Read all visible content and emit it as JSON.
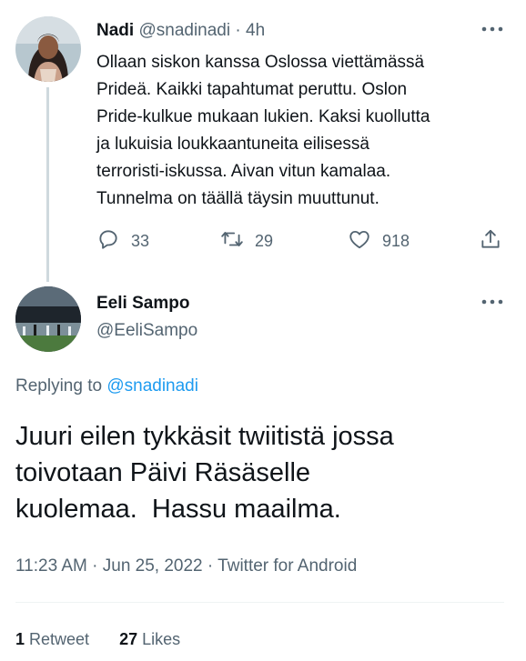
{
  "parent_tweet": {
    "author_name": "Nadi",
    "author_handle": "@snadinadi",
    "separator": " · ",
    "time_ago": "4h",
    "lines": [
      "Ollaan siskon kanssa Oslossa viettämässä",
      "Prideä. Kaikki tapahtumat peruttu. Oslon",
      "Pride-kulkue mukaan lukien. Kaksi kuollutta",
      "ja lukuisia loukkaantuneita eilisessä",
      "terroristi-iskussa. Aivan vitun kamalaa.",
      "Tunnelma on täällä täysin muuttunut."
    ],
    "reply_count": "33",
    "retweet_count": "29",
    "like_count": "918"
  },
  "reply_tweet": {
    "author_name": "Eeli Sampo",
    "author_handle": "@EeliSampo",
    "replying_prefix": "Replying to ",
    "replying_to": "@snadinadi",
    "lines": [
      "Juuri eilen tykkäsit twiitistä jossa",
      "toivotaan Päivi Räsäselle",
      "kuolemaa.  Hassu maailma."
    ],
    "timestamp": "11:23 AM · Jun 25, 2022 · Twitter for Android",
    "retweets_count": "1",
    "retweets_label": " Retweet",
    "likes_count": "27",
    "likes_label": " Likes"
  },
  "icons": {
    "more": "more-horizontal-icon",
    "reply": "reply-bubble-icon",
    "retweet": "retweet-arrows-icon",
    "like": "heart-icon",
    "share": "share-upload-icon"
  },
  "colors": {
    "text_primary": "#0f1419",
    "text_secondary": "#536471",
    "link": "#1d9bf0",
    "thread_line": "#cfd9de",
    "divider": "#eff3f4"
  }
}
